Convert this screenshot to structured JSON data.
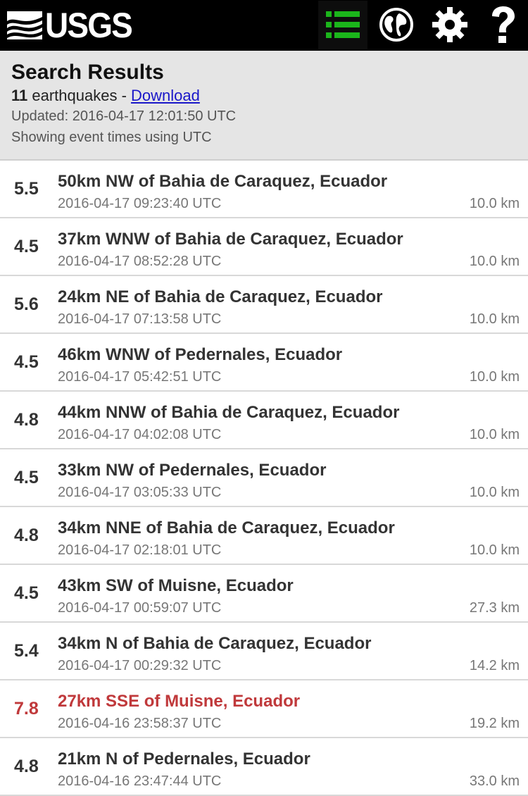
{
  "header": {
    "logo_text": "USGS",
    "nav": [
      {
        "icon": "list-icon",
        "active": true
      },
      {
        "icon": "globe-icon",
        "active": false
      },
      {
        "icon": "gear-icon",
        "active": false
      },
      {
        "icon": "question-icon",
        "active": false
      }
    ],
    "accent_color": "#1bb51b"
  },
  "summary": {
    "title": "Search Results",
    "count": "11",
    "count_suffix": " earthquakes - ",
    "download_label": "Download",
    "updated": "Updated: 2016-04-17 12:01:50 UTC",
    "timezone_note": "Showing event times using UTC"
  },
  "earthquakes": [
    {
      "mag": "5.5",
      "place": "50km NW of Bahia de Caraquez, Ecuador",
      "time": "2016-04-17 09:23:40 UTC",
      "depth": "10.0 km"
    },
    {
      "mag": "4.5",
      "place": "37km WNW of Bahia de Caraquez, Ecuador",
      "time": "2016-04-17 08:52:28 UTC",
      "depth": "10.0 km"
    },
    {
      "mag": "5.6",
      "place": "24km NE of Bahia de Caraquez, Ecuador",
      "time": "2016-04-17 07:13:58 UTC",
      "depth": "10.0 km"
    },
    {
      "mag": "4.5",
      "place": "46km WNW of Pedernales, Ecuador",
      "time": "2016-04-17 05:42:51 UTC",
      "depth": "10.0 km"
    },
    {
      "mag": "4.8",
      "place": "44km NNW of Bahia de Caraquez, Ecuador",
      "time": "2016-04-17 04:02:08 UTC",
      "depth": "10.0 km"
    },
    {
      "mag": "4.5",
      "place": "33km NW of Pedernales, Ecuador",
      "time": "2016-04-17 03:05:33 UTC",
      "depth": "10.0 km"
    },
    {
      "mag": "4.8",
      "place": "34km NNE of Bahia de Caraquez, Ecuador",
      "time": "2016-04-17 02:18:01 UTC",
      "depth": "10.0 km"
    },
    {
      "mag": "4.5",
      "place": "43km SW of Muisne, Ecuador",
      "time": "2016-04-17 00:59:07 UTC",
      "depth": "27.3 km"
    },
    {
      "mag": "5.4",
      "place": "34km N of Bahia de Caraquez, Ecuador",
      "time": "2016-04-17 00:29:32 UTC",
      "depth": "14.2 km"
    },
    {
      "mag": "7.8",
      "place": "27km SSE of Muisne, Ecuador",
      "time": "2016-04-16 23:58:37 UTC",
      "depth": "19.2 km",
      "highlight_color": "#c0393b"
    },
    {
      "mag": "4.8",
      "place": "21km N of Pedernales, Ecuador",
      "time": "2016-04-16 23:47:44 UTC",
      "depth": "33.0 km"
    }
  ]
}
